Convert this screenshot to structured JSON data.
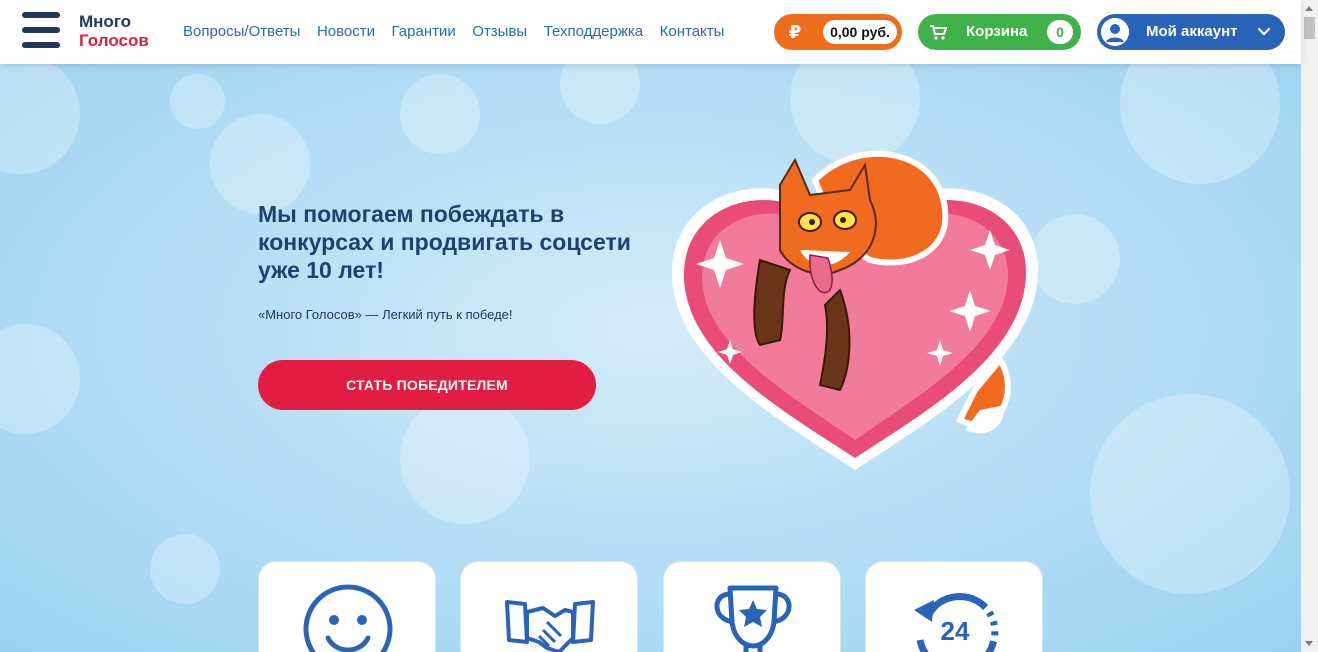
{
  "header": {
    "logo_line1": "Много",
    "logo_line2": "Голосов",
    "nav": [
      "Вопросы/Ответы",
      "Новости",
      "Гарантии",
      "Отзывы",
      "Техподдержка",
      "Контакты"
    ],
    "balance": {
      "currency_symbol": "₽",
      "amount": "0,00 руб.",
      "color": "#ed6d1c"
    },
    "cart": {
      "label": "Корзина",
      "count": "0",
      "color": "#3fb24a",
      "icon": "cart-icon"
    },
    "account": {
      "label": "Мой аккаунт",
      "color": "#2a64b8",
      "icon": "user-icon"
    }
  },
  "hero": {
    "headline": "Мы помогаем побеждать в конкурсах и продвигать соцсети уже 10 лет!",
    "subline": "«Много Голосов» — Легкий путь к победе!",
    "cta_label": "СТАТЬ ПОБЕДИТЕЛЕМ",
    "cta_color": "#e11d42"
  },
  "feature_icons": [
    "smiley-icon",
    "handshake-icon",
    "trophy-icon",
    "clock-24-icon"
  ],
  "colors": {
    "brand_dark": "#22375a",
    "brand_red": "#e0203f",
    "link": "#2a6bb5"
  }
}
